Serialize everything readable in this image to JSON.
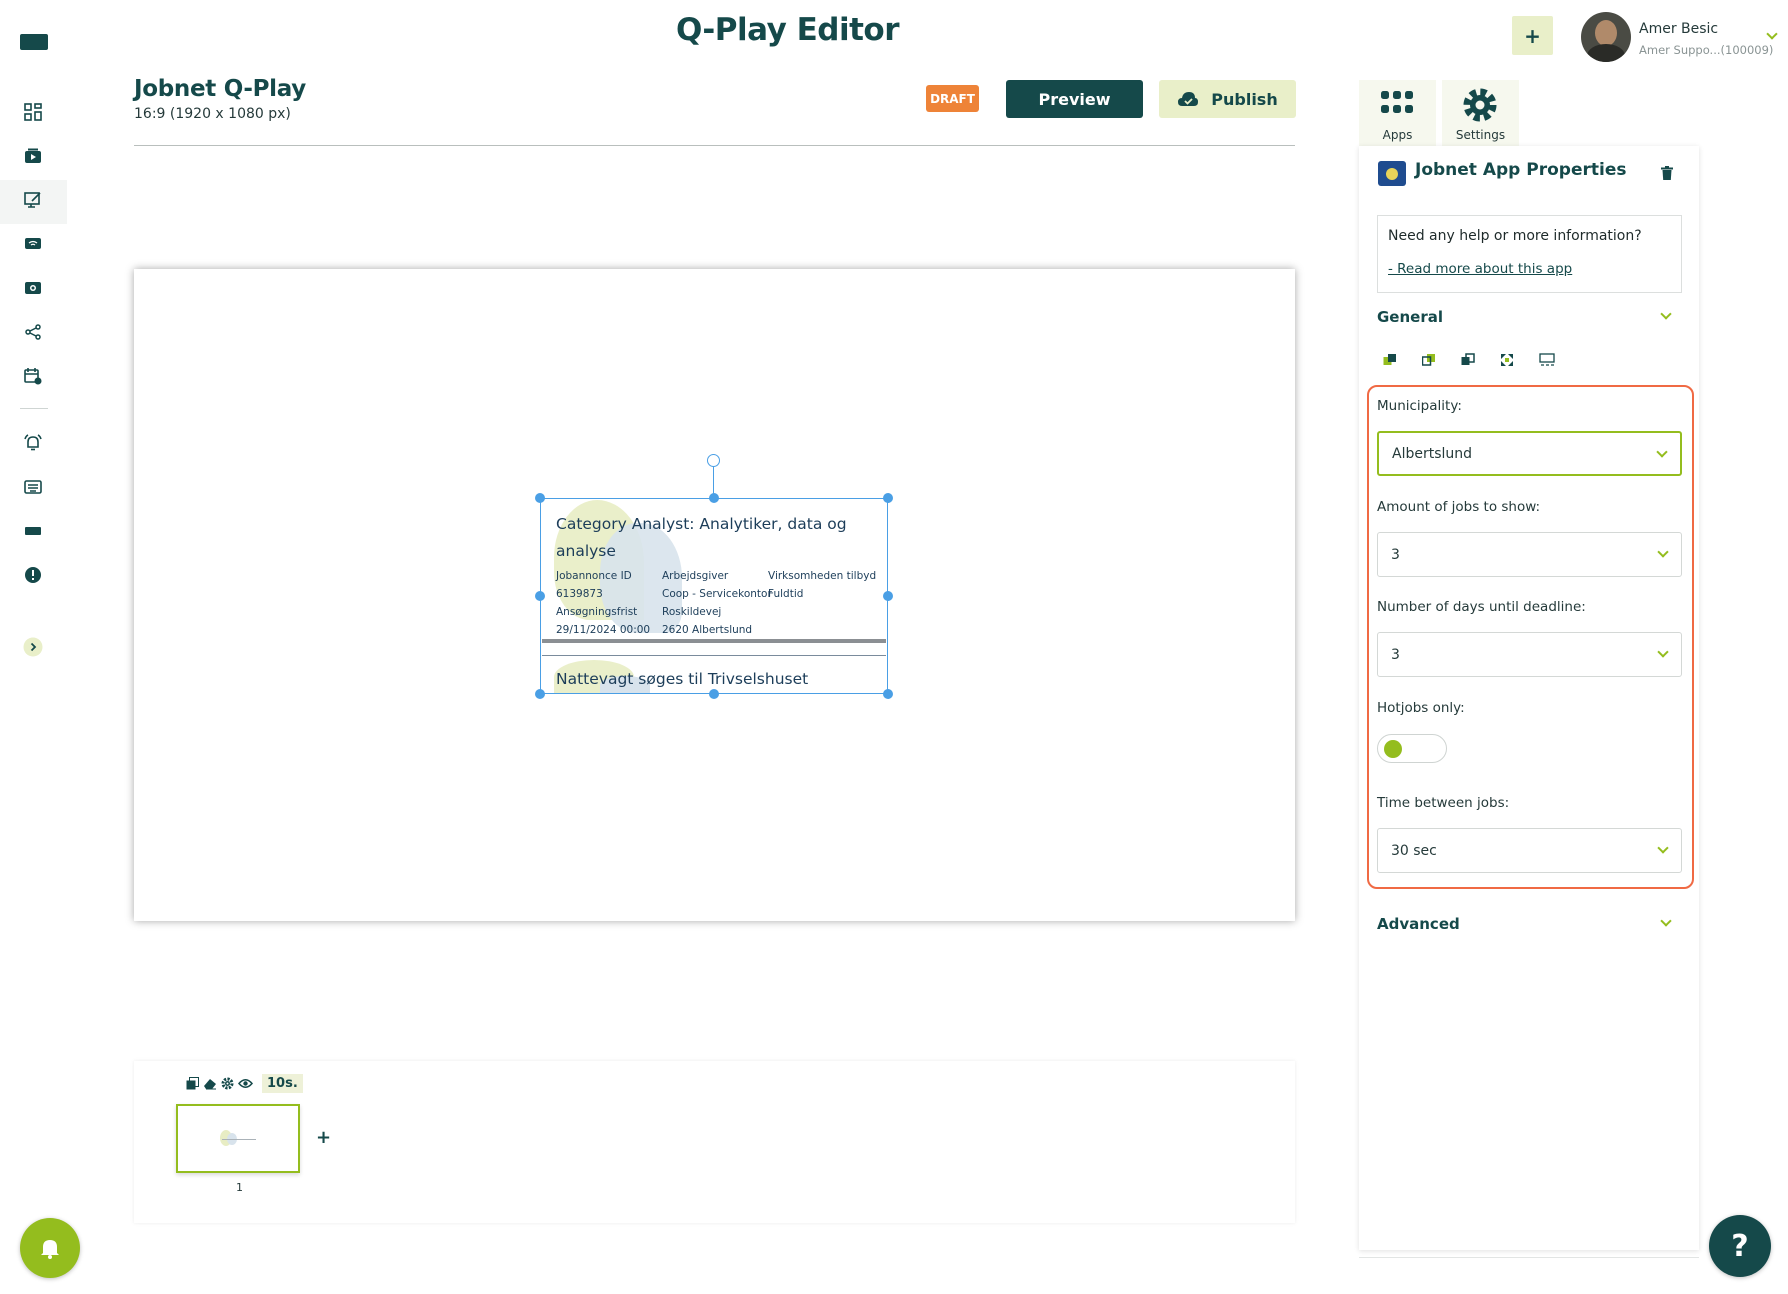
{
  "header": {
    "app_title": "Q-Play Editor",
    "add_label": "+",
    "user_name": "Amer Besic",
    "user_org": "Amer Suppo...(100009)"
  },
  "document": {
    "title": "Jobnet Q-Play",
    "resolution": "16:9 (1920 x 1080 px)",
    "status_badge": "DRAFT",
    "preview_label": "Preview",
    "publish_label": "Publish"
  },
  "canvas_widget": {
    "job1": {
      "title_line1": "Category Analyst: Analytiker, data og",
      "title_line2": "analyse",
      "col1_label": "Jobannonce ID",
      "col1_value": "6139873",
      "col2_label": "Arbejdsgiver",
      "col2_value": "Coop - Servicekontor",
      "col3_label": "Virksomheden tilbyd",
      "col3_value": "Fuldtid",
      "col4_label": "Ansøgningsfrist",
      "col4_value": "29/11/2024 00:00",
      "col5_label": "Roskildevej",
      "col5_value": "2620 Albertslund"
    },
    "job2": {
      "title": "Nattevagt søges til Trivselshuset"
    }
  },
  "timeline": {
    "duration": "10s.",
    "slide_number": "1",
    "add_label": "+"
  },
  "panel": {
    "tabs": [
      {
        "label": "Apps"
      },
      {
        "label": "Settings"
      }
    ],
    "title": "Jobnet App Properties",
    "help_text": "Need any help or more information?",
    "help_link": "- Read more about this app",
    "general_label": "General",
    "advanced_label": "Advanced",
    "municipality_label": "Municipality:",
    "municipality_value": "Albertslund",
    "jobs_label": "Amount of jobs to show:",
    "jobs_value": "3",
    "days_label": "Number of days until deadline:",
    "days_value": "3",
    "hotjobs_label": "Hotjobs only:",
    "hotjobs_on": true,
    "time_label": "Time between jobs:",
    "time_value": "30 sec"
  },
  "help_button_label": "?",
  "colors": {
    "primary": "#15494a",
    "accent": "#94bd1e",
    "accent_light": "#e9efc9",
    "draft": "#ee8338",
    "highlight": "#f06a44",
    "selection": "#4a9fe5"
  }
}
